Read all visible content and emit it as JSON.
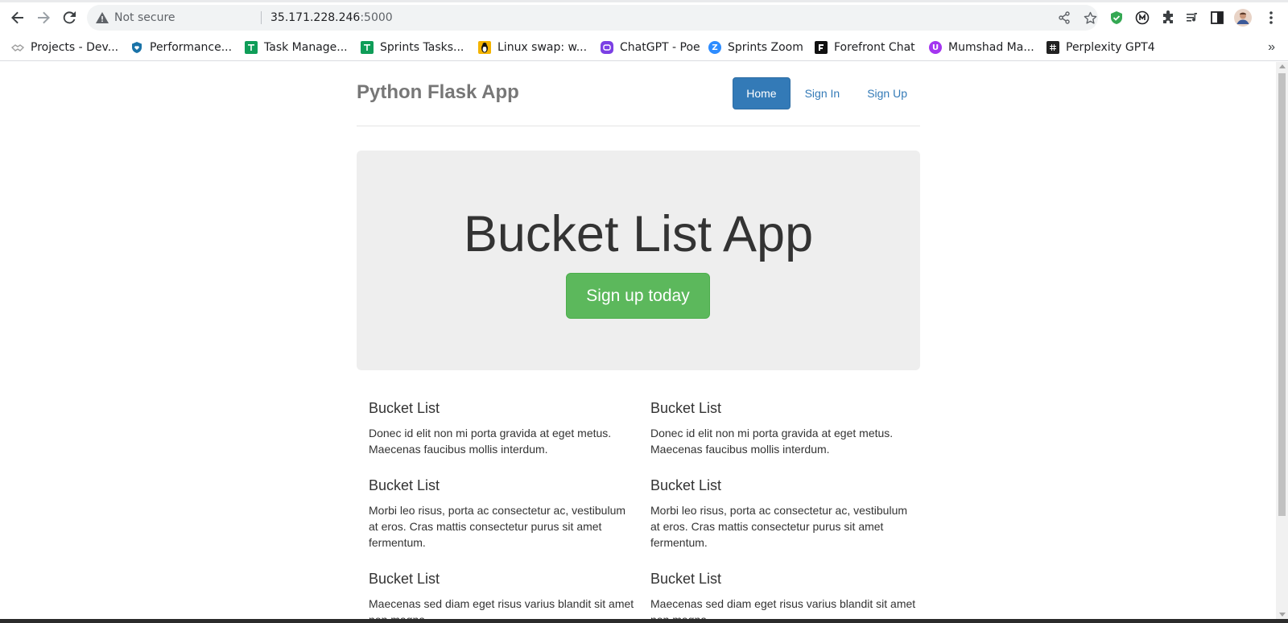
{
  "browser": {
    "security_label": "Not secure",
    "url_host": "35.171.228.246",
    "url_port": ":5000",
    "icons": [
      "back-arrow-icon",
      "forward-arrow-icon",
      "reload-icon",
      "warning-icon",
      "share-icon",
      "star-icon",
      "shield-icon",
      "puzzle-icon",
      "media-icon",
      "sidepanel-icon",
      "menu-icon"
    ]
  },
  "bookmarks": [
    {
      "label": "Projects - Dev...",
      "icon": "handshake-icon",
      "color": "#9e9e9e"
    },
    {
      "label": "Performance...",
      "icon": "shield-heart-icon",
      "color": "#1a73a8"
    },
    {
      "label": "Task Manage...",
      "icon": "sheets-icon",
      "color": "#0f9d58"
    },
    {
      "label": "Sprints Tasks...",
      "icon": "sheets-icon",
      "color": "#0f9d58"
    },
    {
      "label": "Linux swap: w...",
      "icon": "penguin-icon",
      "color": "#f4b400"
    },
    {
      "label": "ChatGPT - Poe",
      "icon": "poe-icon",
      "color": "#7b3fe4"
    },
    {
      "label": "Sprints Zoom",
      "icon": "zoom-icon",
      "color": "#2d8cff"
    },
    {
      "label": "Forefront Chat",
      "icon": "forefront-icon",
      "color": "#111111"
    },
    {
      "label": "Mumshad Ma...",
      "icon": "udemy-icon",
      "color": "#a435f0"
    },
    {
      "label": "Perplexity GPT4",
      "icon": "grid-icon",
      "color": "#222222"
    }
  ],
  "page": {
    "brand": "Python Flask App",
    "nav": [
      {
        "label": "Home",
        "active": true
      },
      {
        "label": "Sign In",
        "active": false
      },
      {
        "label": "Sign Up",
        "active": false
      }
    ],
    "hero_title": "Bucket List App",
    "hero_button": "Sign up today",
    "columns": [
      [
        {
          "title": "Bucket List",
          "text": "Donec id elit non mi porta gravida at eget metus. Maecenas faucibus mollis interdum."
        },
        {
          "title": "Bucket List",
          "text": "Morbi leo risus, porta ac consectetur ac, vestibulum at eros. Cras mattis consectetur purus sit amet fermentum."
        },
        {
          "title": "Bucket List",
          "text": "Maecenas sed diam eget risus varius blandit sit amet non magna."
        }
      ],
      [
        {
          "title": "Bucket List",
          "text": "Donec id elit non mi porta gravida at eget metus. Maecenas faucibus mollis interdum."
        },
        {
          "title": "Bucket List",
          "text": "Morbi leo risus, porta ac consectetur ac, vestibulum at eros. Cras mattis consectetur purus sit amet fermentum."
        },
        {
          "title": "Bucket List",
          "text": "Maecenas sed diam eget risus varius blandit sit amet non magna."
        }
      ]
    ],
    "colors": {
      "primary": "#337ab7",
      "success": "#5cb85c",
      "jumbotron": "#eeeeee"
    }
  }
}
